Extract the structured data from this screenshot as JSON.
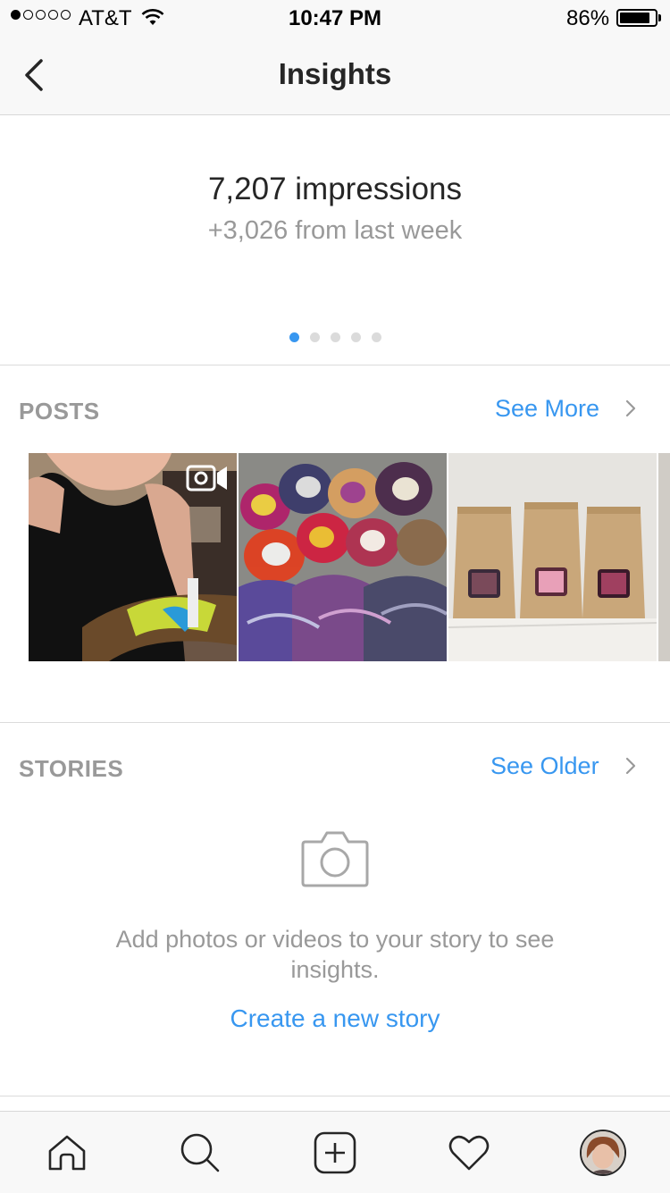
{
  "status_bar": {
    "carrier": "AT&T",
    "time": "10:47 PM",
    "battery_percent": "86%",
    "battery_level": 0.86,
    "signal_bars": 1,
    "signal_total": 5
  },
  "header": {
    "title": "Insights",
    "back_icon": "chevron-left-icon"
  },
  "impressions": {
    "headline": "7,207 impressions",
    "change": "+3,026 from last week",
    "page_count": 5,
    "active_page": 0
  },
  "posts": {
    "heading": "POSTS",
    "see_more": "See More",
    "thumbnails": [
      {
        "name": "post-thumbnail-video",
        "is_video": true
      },
      {
        "name": "post-thumbnail-yarn-skeins",
        "is_video": false
      },
      {
        "name": "post-thumbnail-yarn-bags",
        "is_video": false
      }
    ]
  },
  "stories": {
    "heading": "STORIES",
    "see_older": "See Older",
    "empty_message": "Add photos or videos to your story to see insights.",
    "create_link": "Create a new story"
  },
  "tab_bar": {
    "items": [
      "home-icon",
      "search-icon",
      "add-icon",
      "heart-icon",
      "profile-avatar"
    ]
  },
  "colors": {
    "accent": "#3897f0",
    "muted_text": "#999999",
    "primary_text": "#262626",
    "divider": "#dbdbdb"
  }
}
